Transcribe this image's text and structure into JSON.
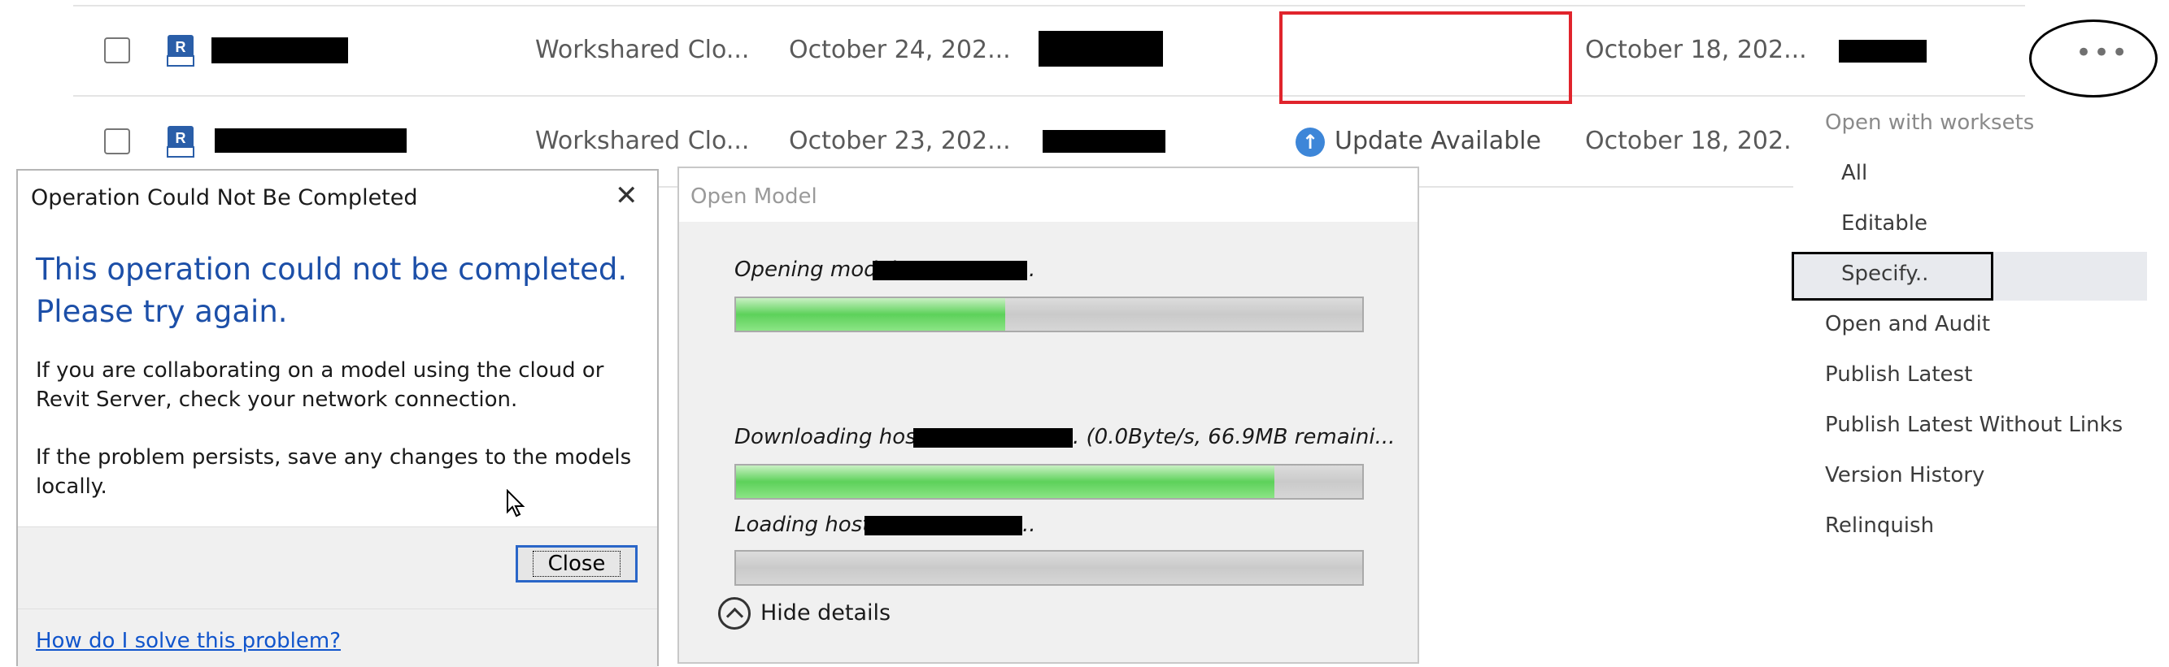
{
  "rows": [
    {
      "type": "Workshared Clo...",
      "modified": "October 24, 202...",
      "status": "",
      "date2": "October 18, 202..."
    },
    {
      "type": "Workshared Clo...",
      "modified": "October 23, 202...",
      "status": "Update Available",
      "date2": "October 18, 202..."
    }
  ],
  "file_icon_letter": "R",
  "more_button": {
    "glyph": "•••"
  },
  "menu": {
    "header": "Open with worksets",
    "worksets": [
      "All",
      "Editable",
      "Specify.."
    ],
    "items": [
      "Open and Audit",
      "Publish Latest",
      "Publish Latest Without Links",
      "Version History",
      "Relinquish"
    ]
  },
  "error_dialog": {
    "title": "Operation Could Not Be Completed",
    "close_glyph": "✕",
    "heading": "This operation could not be completed. Please try again.",
    "para1": "If you are collaborating on a model using the cloud or Revit Server, check your network connection.",
    "para2": "If the problem persists, save any changes to the models locally.",
    "close_button": "Close",
    "help_link": "How do I solve this problem?"
  },
  "open_model_dialog": {
    "title": "Open Model",
    "opening_label": "Opening model:",
    "opening_progress": 0.43,
    "downloading_label": "Downloading host:",
    "downloading_suffix": ". (0.0Byte/s, 66.9MB remaini...",
    "downloading_progress": 0.86,
    "loading_label": "Loading host:",
    "loading_progress": 0.0,
    "hide_details": "Hide details"
  },
  "colors": {
    "accent_red": "#e0242c",
    "link_blue": "#1155cc",
    "heading_blue": "#1c4fa8",
    "update_blue": "#3d86d8",
    "progress_green": "#5dd15a"
  }
}
